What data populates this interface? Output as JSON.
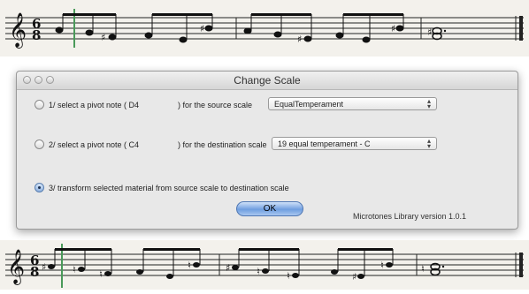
{
  "dialog": {
    "title": "Change Scale",
    "row1": {
      "label_pre": "1/ select a pivot note  ( D4",
      "label_post": ") for the source scale",
      "scale_value": "EqualTemperament",
      "selected": false
    },
    "row2": {
      "label_pre": "2/ select a pivot note  ( C4",
      "label_post": ") for the destination scale",
      "scale_value": "19 equal temperament - C",
      "selected": false
    },
    "row3": {
      "label": "3/ transform selected material from source scale to destination scale",
      "selected": true
    },
    "ok_label": "OK",
    "version": "Microtones Library version 1.0.1"
  },
  "score": {
    "time_signature": "6/8",
    "clef": "treble-clef",
    "top_staff_accidentals": [
      "sharp"
    ],
    "bottom_staff_accidentals": [
      "sharp",
      "natural-variant"
    ]
  },
  "colors": {
    "cursor_line": "#4a9a5a",
    "ok_button": "#6f9ee0",
    "staff_background": "#f3f1ec"
  }
}
